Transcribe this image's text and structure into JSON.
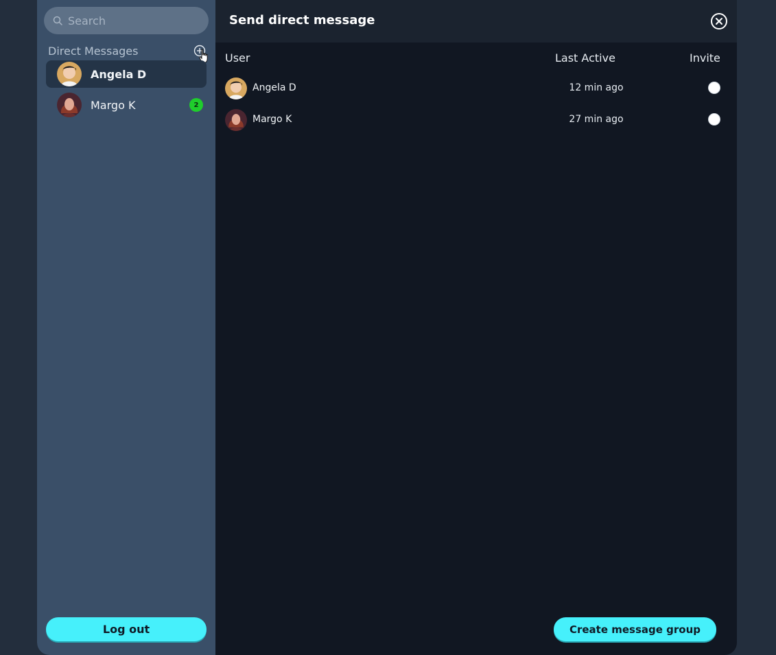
{
  "sidebar": {
    "search": {
      "placeholder": "Search",
      "value": ""
    },
    "section_title": "Direct Messages",
    "contacts": [
      {
        "name": "Angela D",
        "active": true,
        "unread": null
      },
      {
        "name": "Margo K",
        "active": false,
        "unread": "2"
      }
    ],
    "logout_label": "Log out"
  },
  "dialog": {
    "title": "Send direct message",
    "columns": {
      "user": "User",
      "last_active": "Last Active",
      "invite": "Invite"
    },
    "rows": [
      {
        "user": "Angela D",
        "last_active": "12 min ago",
        "invited": false
      },
      {
        "user": "Margo K",
        "last_active": "27 min ago",
        "invited": false
      }
    ],
    "create_group_label": "Create message group"
  },
  "icons": {
    "search": "search-icon",
    "add": "plus-circle-icon",
    "close": "close-circle-icon",
    "cursor": "hand-pointer-icon"
  },
  "colors": {
    "accent": "#46f0fb",
    "sidebar_bg": "#3a4f68",
    "main_bg": "#111722",
    "badge": "#1fcd2c"
  }
}
